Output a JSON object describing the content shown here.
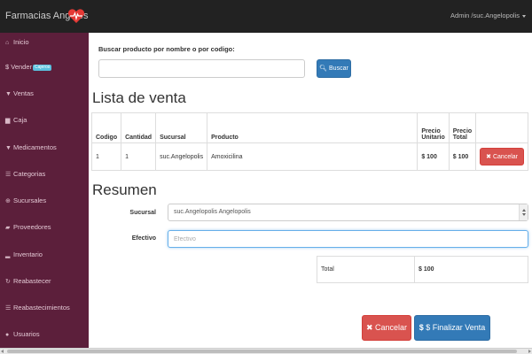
{
  "navbar": {
    "brand": "Farmacias Angeles",
    "user": "Admin /suc.Angelopolis"
  },
  "sidebar": {
    "items": [
      {
        "icon": "home-icon",
        "glyph": "⌂",
        "label": "Inicio"
      },
      {
        "icon": "dollar-icon",
        "glyph": "",
        "label": "$ Vender",
        "badge": "Cajeros"
      },
      {
        "icon": "cart-icon",
        "glyph": "▼",
        "label": "Ventas"
      },
      {
        "icon": "cash-icon",
        "glyph": "▆",
        "label": "Caja"
      },
      {
        "icon": "filter-icon",
        "glyph": "▼",
        "label": "Medicamentos"
      },
      {
        "icon": "list-icon",
        "glyph": "☰",
        "label": "Categorias"
      },
      {
        "icon": "globe-icon",
        "glyph": "⊕",
        "label": "Sucursales"
      },
      {
        "icon": "truck-icon",
        "glyph": "▰",
        "label": "Proveedores"
      },
      {
        "icon": "chart-icon",
        "glyph": "▂",
        "label": "Inventario"
      },
      {
        "icon": "refresh-icon",
        "glyph": "↻",
        "label": "Reabastecer"
      },
      {
        "icon": "list-icon",
        "glyph": "☰",
        "label": "Reabastecimientos"
      },
      {
        "icon": "users-icon",
        "glyph": "●",
        "label": "Usuarios"
      }
    ]
  },
  "search": {
    "label": "Buscar producto por nombre o por codigo:",
    "value": "",
    "button_label": "Buscar"
  },
  "sale_list": {
    "title": "Lista de venta",
    "headers": [
      "Codigo",
      "Cantidad",
      "Sucursal",
      "Producto",
      "Precio Unitario",
      "Precio Total",
      ""
    ],
    "rows": [
      {
        "codigo": "1",
        "cantidad": "1",
        "sucursal": "suc.Angelopolis",
        "producto": "Amoxicilina",
        "precio_unitario": "$ 100",
        "precio_total": "$ 100",
        "action_label": "Cancelar"
      }
    ]
  },
  "summary": {
    "title": "Resumen",
    "sucursal_label": "Sucursal",
    "sucursal_value": "suc.Angelopolis Angelopolis",
    "efectivo_label": "Efectivo",
    "efectivo_placeholder": "Efectivo",
    "total_label": "Total",
    "total_value": "$ 100"
  },
  "actions": {
    "cancel_label": "Cancelar",
    "finalize_label": "$ Finalizar Venta"
  },
  "colors": {
    "navbar": "#222222",
    "sidebar": "#5c1f3b",
    "primary": "#337ab7",
    "danger": "#d9534f",
    "heart": "#e53935"
  }
}
